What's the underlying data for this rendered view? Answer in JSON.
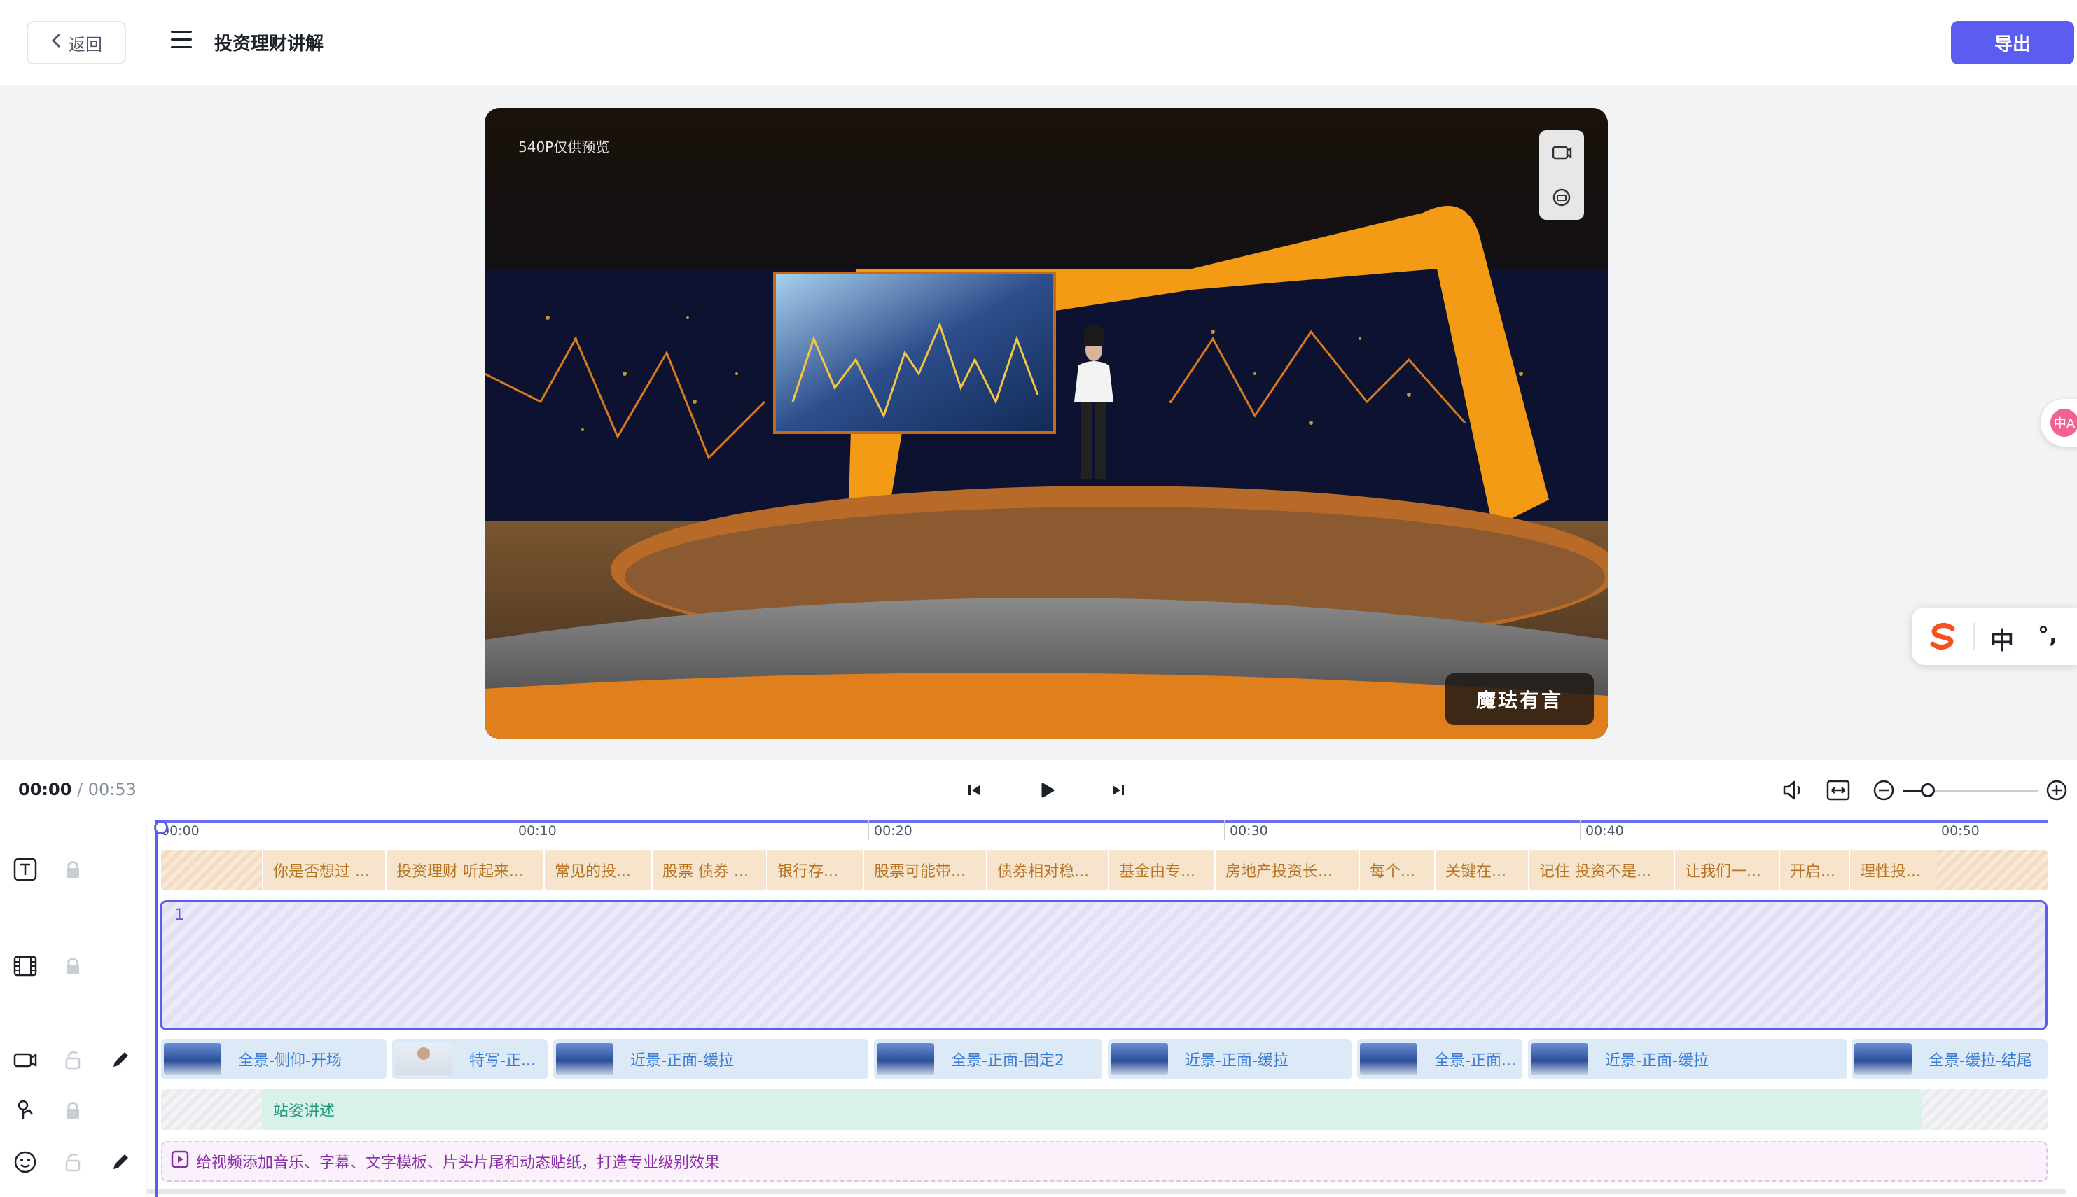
{
  "header": {
    "back_label": "返回",
    "title": "投资理财讲解",
    "export_label": "导出"
  },
  "preview": {
    "quality_label": "540P仅供预览",
    "watermark": "魔珐有言"
  },
  "ime": {
    "language": "中",
    "punct": "°,"
  },
  "translate_widget": {
    "icon_text": "中A"
  },
  "playback": {
    "current_time": "00:00",
    "separator": " / ",
    "total_time": "00:53",
    "zoom_level": 0.18
  },
  "timeline": {
    "ruler_labels": [
      "00:00",
      "00:10",
      "00:20",
      "00:30",
      "00:40",
      "00:50"
    ],
    "subtitles": [
      "你是否想过 ...",
      "投资理财 听起来...",
      "常见的投...",
      "股票 债券 ...",
      "银行存...",
      "股票可能带...",
      "债券相对稳...",
      "基金由专...",
      "房地产投资长...",
      "每个...",
      "关键在...",
      "记住 投资不是...",
      "让我们一...",
      "开启...",
      "理性投..."
    ],
    "video_clip_number": "1",
    "camera_clips": [
      "全景-侧仰-开场",
      "特写-正...",
      "近景-正面-缓拉",
      "全景-正面-固定2",
      "近景-正面-缓拉",
      "全景-正面...",
      "近景-正面-缓拉",
      "全景-缓拉-结尾"
    ],
    "pose_clip": "站姿讲述",
    "effects_hint": "给视频添加音乐、字幕、文字模板、片头片尾和动态贴纸，打造专业级别效果"
  },
  "colors": {
    "accent": "#5b5cf0",
    "subtitle_text": "#b7731f",
    "camera_text": "#3a7bd5",
    "pose_text": "#1f9c7a",
    "effects_text": "#8b2fa8"
  }
}
